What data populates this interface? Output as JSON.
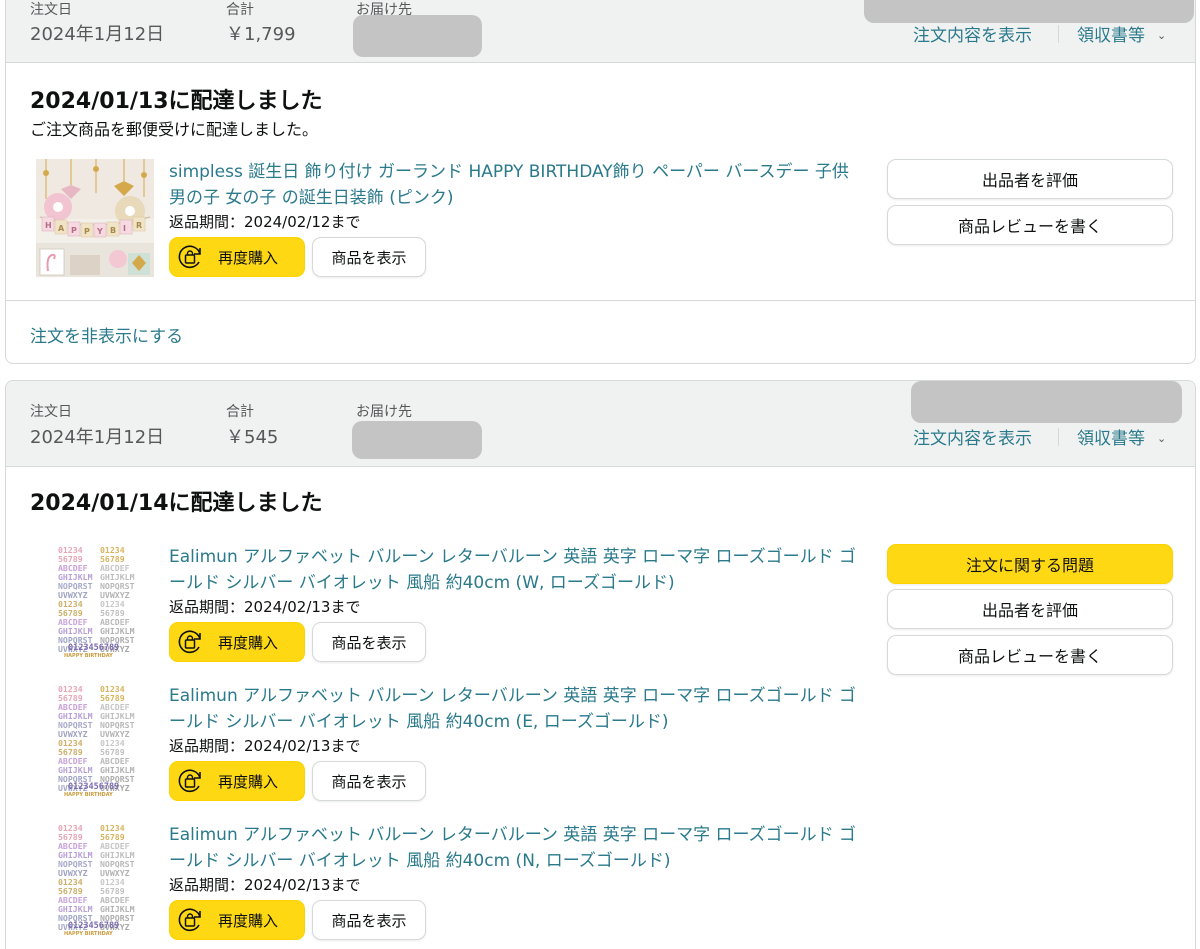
{
  "orders": [
    {
      "header": {
        "order_date_label": "注文日",
        "order_date": "2024年1月12日",
        "total_label": "合計",
        "total": "￥1,799",
        "ship_to_label": "お届け先",
        "view_order": "注文内容を表示",
        "receipts": "領収書等"
      },
      "delivery_title": "2024/01/13に配達しました",
      "delivery_note": "ご注文商品を郵便受けに配達しました。",
      "items": [
        {
          "title": "simpless 誕生日 飾り付け ガーランド HAPPY BIRTHDAY飾り ペーパー バースデー 子供 男の子 女の子 の誕生日装飾 (ピンク)",
          "return_period": "返品期間：2024/02/12まで",
          "buy_again": "再度購入",
          "view_item": "商品を表示"
        }
      ],
      "actions": [
        "出品者を評価",
        "商品レビューを書く"
      ],
      "hide_order": "注文を非表示にする"
    },
    {
      "header": {
        "order_date_label": "注文日",
        "order_date": "2024年1月12日",
        "total_label": "合計",
        "total": "￥545",
        "ship_to_label": "お届け先",
        "view_order": "注文内容を表示",
        "receipts": "領収書等"
      },
      "delivery_title": "2024/01/14に配達しました",
      "items": [
        {
          "title": "Ealimun アルファベット バルーン レターバルーン 英語 英字 ローマ字 ローズゴールド ゴールド シルバー バイオレット 風船 約40cm (W, ローズゴールド)",
          "return_period": "返品期間：2024/02/13まで",
          "buy_again": "再度購入",
          "view_item": "商品を表示"
        },
        {
          "title": "Ealimun アルファベット バルーン レターバルーン 英語 英字 ローマ字 ローズゴールド ゴールド シルバー バイオレット 風船 約40cm (E, ローズゴールド)",
          "return_period": "返品期間：2024/02/13まで",
          "buy_again": "再度購入",
          "view_item": "商品を表示"
        },
        {
          "title": "Ealimun アルファベット バルーン レターバルーン 英語 英字 ローマ字 ローズゴールド ゴールド シルバー バイオレット 風船 約40cm (N, ローズゴールド)",
          "return_period": "返品期間：2024/02/13まで",
          "buy_again": "再度購入",
          "view_item": "商品を表示"
        }
      ],
      "actions": [
        "注文に関する問題",
        "出品者を評価",
        "商品レビューを書く"
      ]
    }
  ],
  "balloon_sheet": {
    "col_a": [
      "01234",
      "56789",
      "ABCDEF",
      "GHIJKLM",
      "NOPQRST",
      "UVWXYZ",
      "01234",
      "56789",
      "ABCDEF",
      "GHIJKLM",
      "NOPQRST",
      "UVWXYZ"
    ],
    "col_b": [
      "01234",
      "56789",
      "ABCDEF",
      "GHIJKLM",
      "NOPQRST",
      "UVWXYZ",
      "01234",
      "56789",
      "ABCDEF",
      "GHIJKLM",
      "NOPQRST",
      "UVWXYZ"
    ],
    "digits": "0123456789",
    "happy": "HAPPY",
    "birthday": "BIRTHDAY"
  },
  "garland_letters": [
    "H",
    "A",
    "P",
    "P",
    "Y",
    "B",
    "I",
    "R",
    "T",
    "H",
    "D",
    "A",
    "Y"
  ],
  "colors": {
    "link": "#2a7a8c",
    "yellow_button": "#ffd814",
    "header_bg": "#f0f2f2",
    "border": "#d5d9d9"
  },
  "icons": {
    "buy_again": "refresh-bag-icon",
    "dropdown": "chevron-down-icon"
  }
}
